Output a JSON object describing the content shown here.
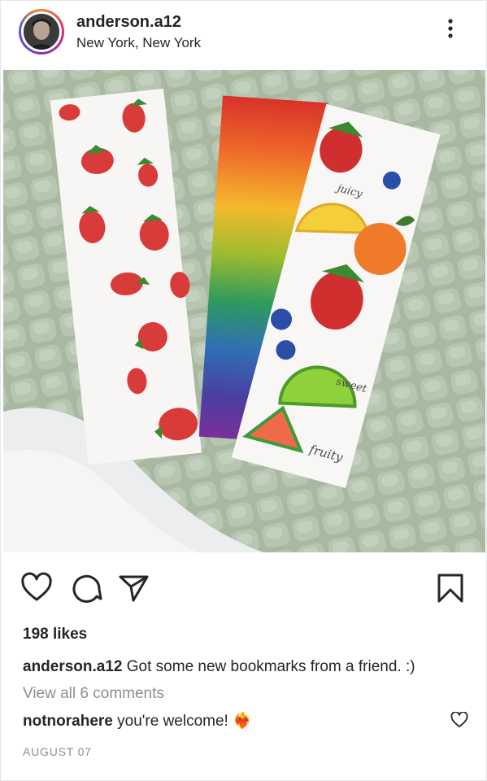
{
  "post": {
    "username": "anderson.a12",
    "location": "New York, New York",
    "likes": "198 likes",
    "caption_user": "anderson.a12",
    "caption_text": "Got some new bookmarks from a friend. :)",
    "view_all_comments": "View all 6 comments",
    "comment_user": "notnorahere",
    "comment_text": "you're welcome!",
    "comment_emoji": "❤️‍🔥",
    "date": "AUGUST 07"
  },
  "photo_text": {
    "juicy": "juicy",
    "sweet": "sweet",
    "fruity": "fruity"
  },
  "icons": {
    "avatar": "avatar",
    "more": "more-options-icon",
    "like": "heart-icon",
    "comment": "comment-bubble-icon",
    "share": "paper-plane-icon",
    "save": "bookmark-icon",
    "comment_like": "small-heart-icon"
  },
  "colors": {
    "text": "#262626",
    "muted": "#8e8e8e",
    "border": "#e6e6e6",
    "blanket": "#a9b8a1"
  }
}
